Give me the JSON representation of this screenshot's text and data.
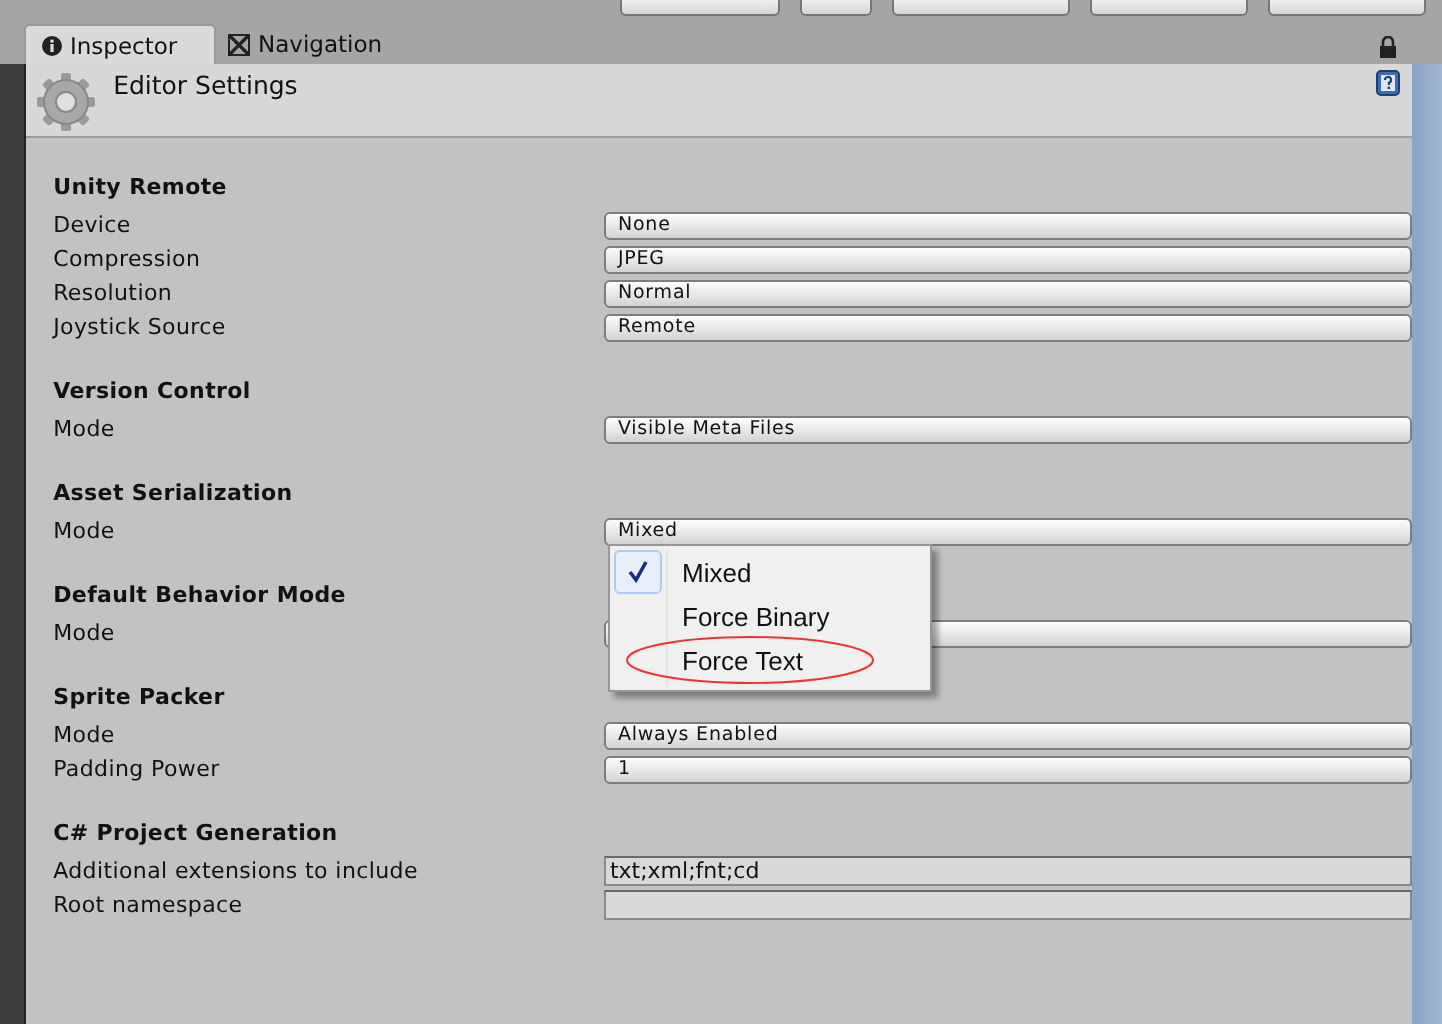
{
  "tabs": [
    {
      "label": "Inspector",
      "kind": "info",
      "selected": true
    },
    {
      "label": "Navigation",
      "kind": "nav",
      "selected": false
    }
  ],
  "header": {
    "title": "Editor Settings"
  },
  "sections": [
    {
      "title": "Unity Remote",
      "rows": [
        {
          "label": "Device",
          "kind": "dropdown",
          "value": "None"
        },
        {
          "label": "Compression",
          "kind": "dropdown",
          "value": "JPEG"
        },
        {
          "label": "Resolution",
          "kind": "dropdown",
          "value": "Normal"
        },
        {
          "label": "Joystick Source",
          "kind": "dropdown",
          "value": "Remote"
        }
      ]
    },
    {
      "title": "Version Control",
      "rows": [
        {
          "label": "Mode",
          "kind": "dropdown",
          "value": "Visible Meta Files"
        }
      ]
    },
    {
      "title": "Asset Serialization",
      "rows": [
        {
          "label": "Mode",
          "kind": "dropdown",
          "value": "Mixed"
        }
      ]
    },
    {
      "title": "Default Behavior Mode",
      "rows": [
        {
          "label": "Mode",
          "kind": "dropdown"
        }
      ]
    },
    {
      "title": "Sprite Packer",
      "rows": [
        {
          "label": "Mode",
          "kind": "dropdown",
          "value": "Always Enabled"
        },
        {
          "label": "Padding Power",
          "kind": "dropdown",
          "value": "1"
        }
      ]
    },
    {
      "title": "C# Project Generation",
      "rows": [
        {
          "label": "Additional extensions to include",
          "kind": "text",
          "value": "txt;xml;fnt;cd"
        },
        {
          "label": "Root namespace",
          "kind": "text"
        }
      ]
    }
  ],
  "popup_menu": {
    "items": [
      {
        "label": "Mixed",
        "selected": true
      },
      {
        "label": "Force Binary",
        "selected": false
      },
      {
        "label": "Force Text",
        "selected": false,
        "annotated": true
      }
    ]
  }
}
